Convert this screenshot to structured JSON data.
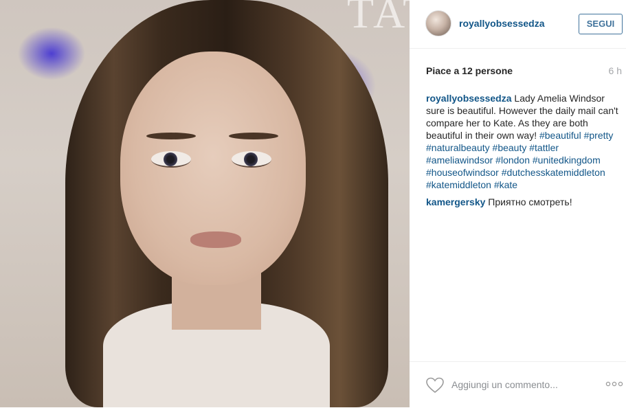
{
  "photo": {
    "masthead": "TATL",
    "alt": "Portrait photo"
  },
  "post": {
    "username": "royallyobsessedza",
    "follow_label": "SEGUI",
    "likes": "Piace a 12 persone",
    "time": "6 h",
    "caption": {
      "username": "royallyobsessedza",
      "text": " Lady Amelia Windsor sure is beautiful. However the daily mail can't compare her to Kate. As they are both beautiful in their own way! ",
      "hashtags": [
        "#beautiful",
        "#pretty",
        "#naturalbeauty",
        "#beauty",
        "#tattler",
        "#ameliawindsor",
        "#london",
        "#unitedkingdom",
        "#houseofwindsor",
        "#dutchesskatemiddleton",
        "#katemiddleton",
        "#kate"
      ]
    },
    "comments": [
      {
        "username": "kamergersky",
        "text": " Приятно смотреть!"
      }
    ],
    "add_comment_placeholder": "Aggiungi un commento...",
    "icons": {
      "like": "heart-icon",
      "more": "more-options-icon"
    }
  }
}
